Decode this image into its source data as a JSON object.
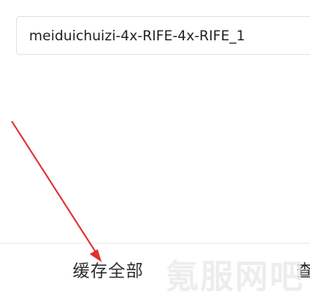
{
  "name_field": {
    "value": "meiduichuizi-4x-RIFE-4x-RIFE_1"
  },
  "bottom_bar": {
    "cache_all_label": "缓存全部",
    "next_label_partial": "查"
  },
  "watermark": {
    "text": "氪服网吧"
  },
  "annotation": {
    "arrow_color": "#e03131"
  }
}
